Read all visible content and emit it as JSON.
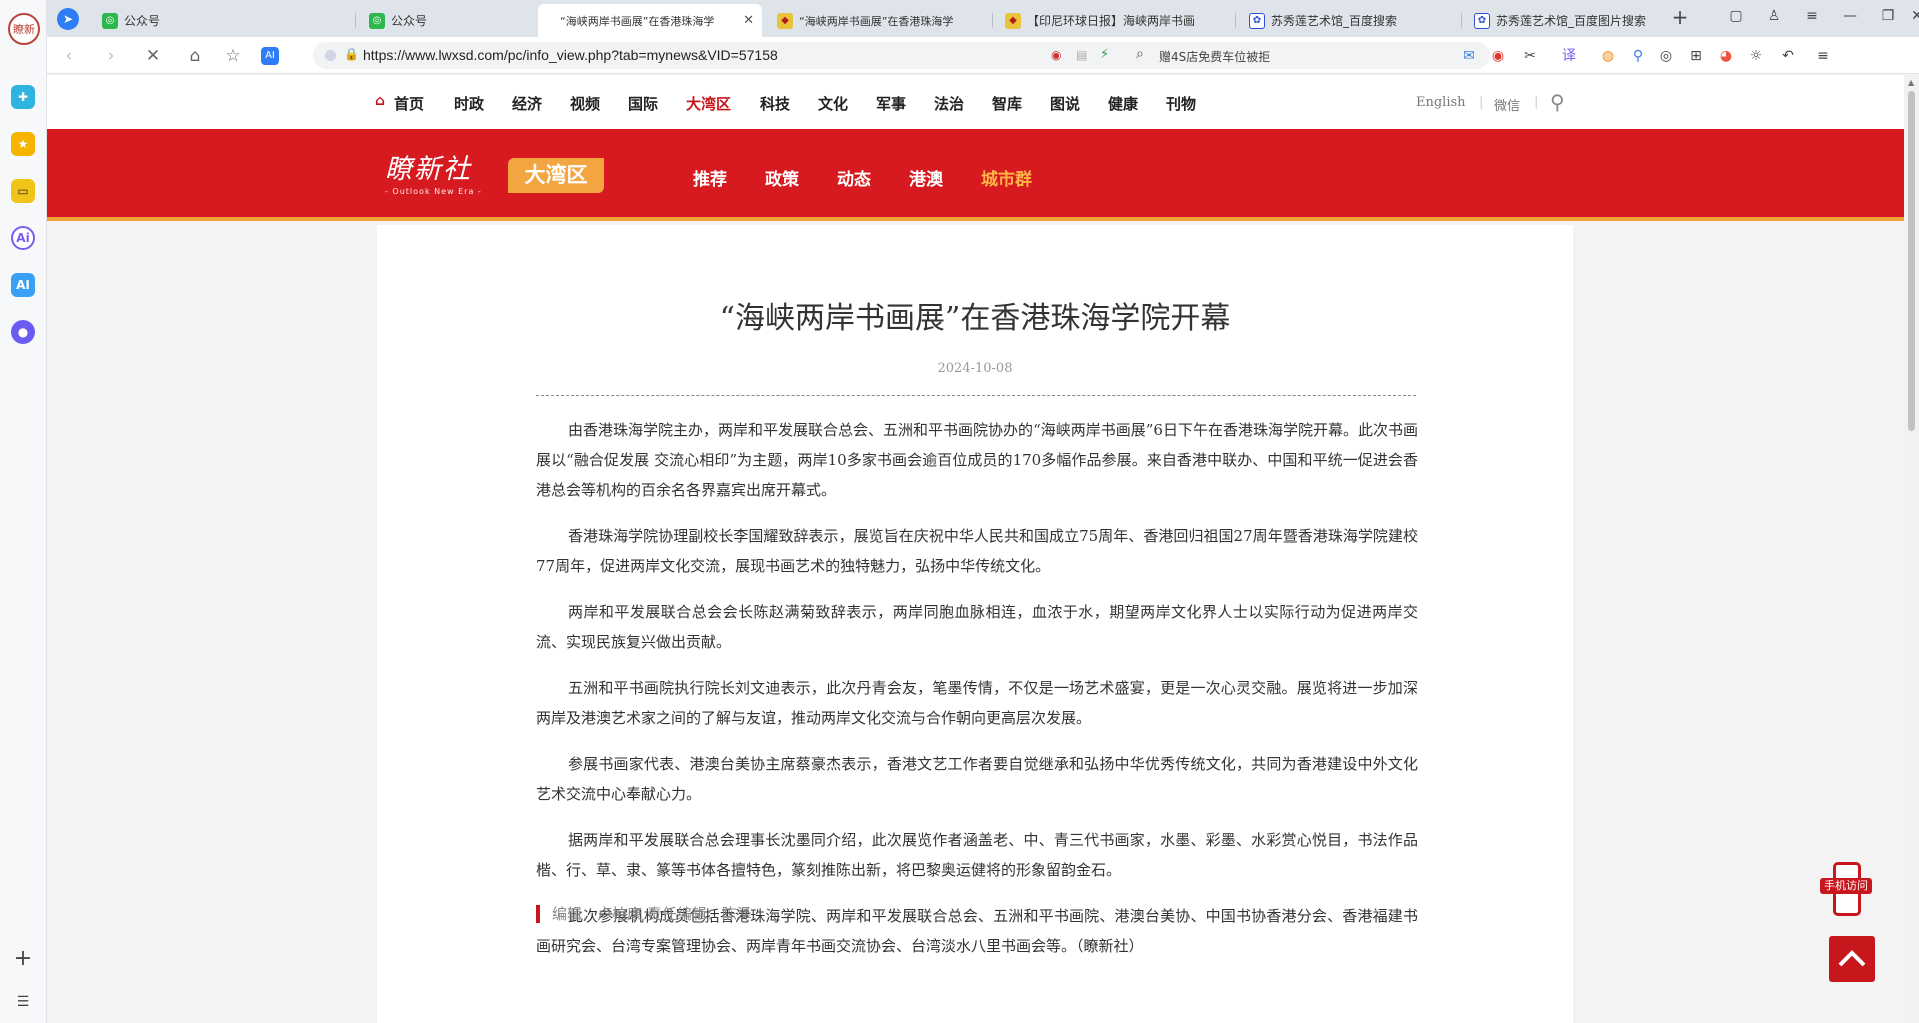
{
  "browser": {
    "avatar_text": "瞭新",
    "tabs": [
      {
        "label": "公众号",
        "active": false
      },
      {
        "label": "公众号",
        "active": false
      },
      {
        "label": "“海峡两岸书画展”在香港珠海学",
        "active": true
      },
      {
        "label": "“海峡两岸书画展”在香港珠海学",
        "active": false
      },
      {
        "label": "【印尼环球日报】海峡两岸书画",
        "active": false
      },
      {
        "label": "苏秀莲艺术馆_百度搜索",
        "active": false
      },
      {
        "label": "苏秀莲艺术馆_百度图片搜索",
        "active": false
      }
    ],
    "url": "https://www.lwxsd.com/pc/info_view.php?tab=mynews&VID=57158",
    "search_text": "赠4S店免费车位被拒",
    "ai_label": "AI"
  },
  "site": {
    "menu": [
      {
        "label": "首页"
      },
      {
        "label": "时政"
      },
      {
        "label": "经济"
      },
      {
        "label": "视频"
      },
      {
        "label": "国际"
      },
      {
        "label": "大湾区"
      },
      {
        "label": "科技"
      },
      {
        "label": "文化"
      },
      {
        "label": "军事"
      },
      {
        "label": "法治"
      },
      {
        "label": "智库"
      },
      {
        "label": "图说"
      },
      {
        "label": "健康"
      },
      {
        "label": "刊物"
      }
    ],
    "english": "English",
    "weixin": "微信",
    "logo_main": "瞭新社",
    "logo_sub": "- Outlook New Era -",
    "region_tag": "大湾区",
    "submenu": [
      {
        "label": "推荐"
      },
      {
        "label": "政策"
      },
      {
        "label": "动态"
      },
      {
        "label": "港澳"
      },
      {
        "label": "城市群"
      }
    ]
  },
  "article": {
    "title": "“海峡两岸书画展”在香港珠海学院开幕",
    "date": "2024-10-08",
    "paragraphs": [
      "由香港珠海学院主办，两岸和平发展联合总会、五洲和平书画院协办的“海峡两岸书画展”6日下午在香港珠海学院开幕。此次书画展以“融合促发展 交流心相印”为主题，两岸10多家书画会逾百位成员的170多幅作品参展。来自香港中联办、中国和平统一促进会香港总会等机构的百余名各界嘉宾出席开幕式。",
      "香港珠海学院协理副校长李国耀致辞表示，展览旨在庆祝中华人民共和国成立75周年、香港回归祖国27周年暨香港珠海学院建校77周年，促进两岸文化交流，展现书画艺术的独特魅力，弘扬中华传统文化。",
      "两岸和平发展联合总会会长陈赵满菊致辞表示，两岸同胞血脉相连，血浓于水，期望两岸文化界人士以实际行动为促进两岸交流、实现民族复兴做出贡献。",
      "五洲和平书画院执行院长刘文迪表示，此次丹青会友，笔墨传情，不仅是一场艺术盛宴，更是一次心灵交融。展览将进一步加深两岸及港澳艺术家之间的了解与友谊，推动两岸文化交流与合作朝向更高层次发展。",
      "参展书画家代表、港澳台美协主席蔡豪杰表示，香港文艺工作者要自觉继承和弘扬中华优秀传统文化，共同为香港建设中外文化艺术交流中心奉献心力。",
      "据两岸和平发展联合总会理事长沈墨同介绍，此次展览作者涵盖老、中、青三代书画家，水墨、彩墨、水彩赏心悦目，书法作品楷、行、草、隶、篆等书体各擅特色，篆刻推陈出新，将巴黎奥运健将的形象留韵金石。",
      "此次参展机构成员包括香港珠海学院、两岸和平发展联合总会、五洲和平书画院、港澳台美协、中国书协香港分会、香港福建书画研究会、台湾专案管理协会、两岸青年书画交流协会、台湾淡水八里书画会等。（瞭新社）"
    ],
    "editor": "编辑：卢柏康 责任编辑：陈泽"
  },
  "floating": {
    "mobile_label": "手机访问"
  },
  "colors": {
    "brand_red": "#d71920",
    "accent_orange": "#f2a540"
  }
}
